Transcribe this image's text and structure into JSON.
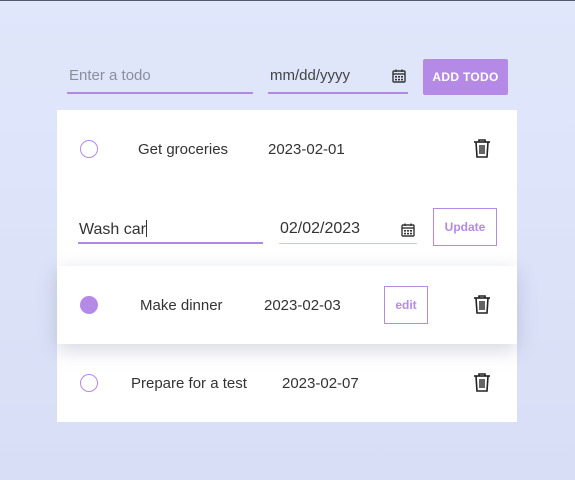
{
  "add_form": {
    "todo_placeholder": "Enter a todo",
    "date_placeholder": "mm/dd/yyyy",
    "add_button_label": "ADD TODO"
  },
  "todos": [
    {
      "title": "Get groceries",
      "date": "2023-02-01",
      "completed": false
    },
    {
      "editing": true,
      "title_value": "Wash car",
      "date_value": "02/02/2023",
      "update_label": "Update"
    },
    {
      "title": "Make dinner",
      "date": "2023-02-03",
      "completed": true,
      "edit_label": "edit"
    },
    {
      "title": "Prepare for a test",
      "date": "2023-02-07",
      "completed": false
    }
  ],
  "colors": {
    "accent": "#b48ae6",
    "background": "#dfe5fa",
    "card": "#ffffff"
  },
  "icons": {
    "calendar": "calendar-icon",
    "delete": "trash-icon"
  }
}
